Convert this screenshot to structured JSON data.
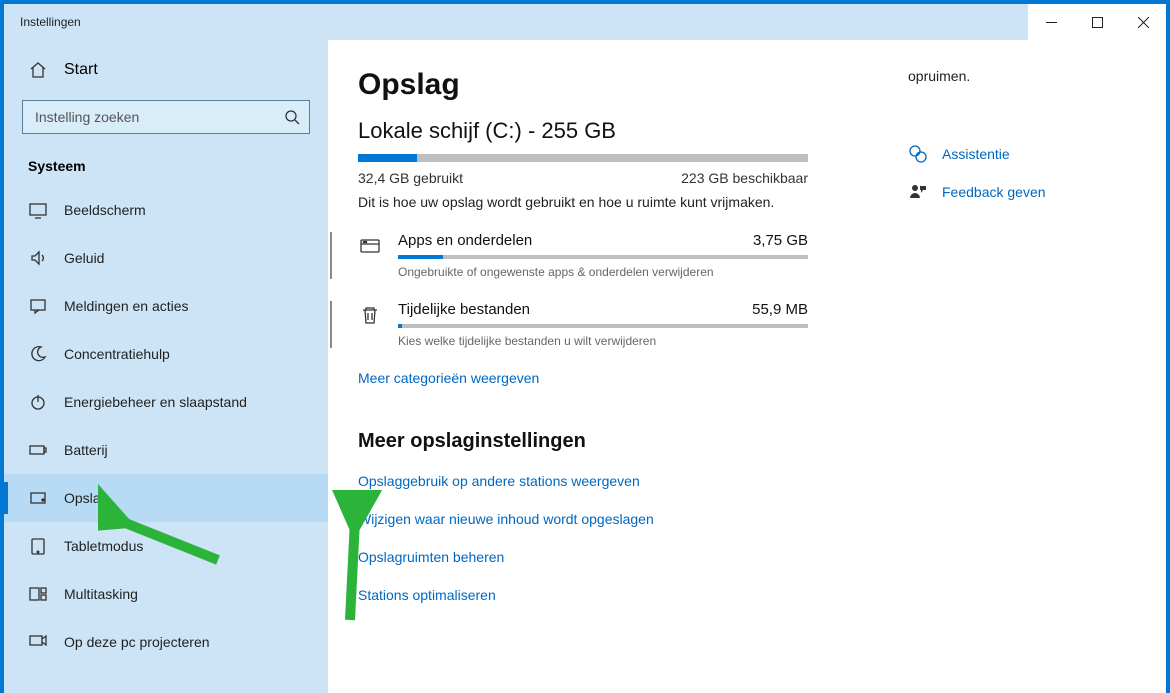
{
  "titlebar": {
    "title": "Instellingen"
  },
  "sidebar": {
    "home": "Start",
    "search_placeholder": "Instelling zoeken",
    "section": "Systeem",
    "items": [
      {
        "label": "Beeldscherm"
      },
      {
        "label": "Geluid"
      },
      {
        "label": "Meldingen en acties"
      },
      {
        "label": "Concentratiehulp"
      },
      {
        "label": "Energiebeheer en slaapstand"
      },
      {
        "label": "Batterij"
      },
      {
        "label": "Opslag"
      },
      {
        "label": "Tabletmodus"
      },
      {
        "label": "Multitasking"
      },
      {
        "label": "Op deze pc projecteren"
      }
    ]
  },
  "main": {
    "title": "Opslag",
    "drive": "Lokale schijf (C:) - 255 GB",
    "used_label": "32,4 GB gebruikt",
    "free_label": "223 GB beschikbaar",
    "desc": "Dit is hoe uw opslag wordt gebruikt en hoe u ruimte kunt vrijmaken.",
    "categories": [
      {
        "name": "Apps en onderdelen",
        "size": "3,75 GB",
        "sub": "Ongebruikte of ongewenste apps & onderdelen verwijderen",
        "fill": "11%"
      },
      {
        "name": "Tijdelijke bestanden",
        "size": "55,9 MB",
        "sub": "Kies welke tijdelijke bestanden u wilt verwijderen",
        "fill": "1%"
      }
    ],
    "more_link": "Meer categorieën weergeven",
    "more_title": "Meer opslaginstellingen",
    "links": [
      "Opslaggebruik op andere stations weergeven",
      "Wijzigen waar nieuwe inhoud wordt opgeslagen",
      "Opslagruimten beheren",
      "Stations optimaliseren"
    ]
  },
  "right": {
    "text": "opruimen.",
    "assist": "Assistentie",
    "feedback": "Feedback geven"
  }
}
